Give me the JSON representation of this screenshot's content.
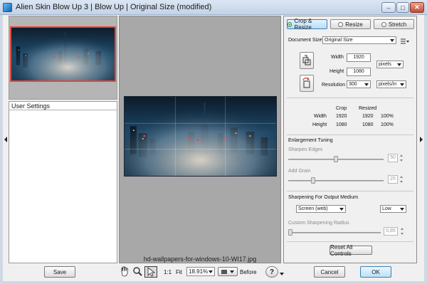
{
  "window": {
    "title": "Alien Skin Blow Up 3 | Blow Up | Original Size (modified)",
    "minimize": "–",
    "maximize": "□",
    "close": "✕"
  },
  "left_panel": {
    "settings_header": "User Settings",
    "save_label": "Save"
  },
  "preview": {
    "file_name": "hd-wallpapers-for-windows-10-WI17.jpg"
  },
  "toolbar": {
    "zoom_1to1": "1:1",
    "fit": "Fit",
    "zoom_value": "18.91%",
    "before": "Before",
    "help": "?"
  },
  "tabs": [
    {
      "label": "Crop & Resize",
      "selected": true
    },
    {
      "label": "Resize",
      "selected": false
    },
    {
      "label": "Stretch",
      "selected": false
    }
  ],
  "document": {
    "size_label": "Document Size",
    "size_value": "Original Size",
    "width_label": "Width",
    "width_value": "1920",
    "height_label": "Height",
    "height_value": "1080",
    "resolution_label": "Resolution",
    "resolution_value": "300",
    "unit_value": "pixels",
    "res_unit_value": "pixels/in"
  },
  "summary": {
    "headers": [
      "Crop",
      "Resized"
    ],
    "rows": [
      {
        "label": "Width",
        "crop": "1920",
        "resized": "1920",
        "pct": "100%"
      },
      {
        "label": "Height",
        "crop": "1080",
        "resized": "1080",
        "pct": "100%"
      }
    ]
  },
  "enlargement": {
    "section": "Enlargement Tuning",
    "sharpen_label": "Sharpen Edges",
    "sharpen_value": "50",
    "sharpen_level": 0.5,
    "grain_label": "Add Grain",
    "grain_value": "25",
    "grain_level": 0.25
  },
  "sharpening": {
    "section": "Sharpening For Output Medium",
    "medium_value": "Screen (web)",
    "amount_value": "Low",
    "radius_label": "Custom Sharpening Radius",
    "radius_value": "0,85",
    "radius_level": 0.0
  },
  "actions": {
    "reset": "Reset All Controls",
    "cancel": "Cancel",
    "ok": "OK"
  },
  "colors": {
    "accent": "#3f7fb7",
    "crop_border": "#e0483a"
  },
  "icons": {
    "crop": "crop-icon",
    "rotate": "rotate-icon",
    "hand": "hand-tool-icon",
    "zoom": "zoom-tool-icon",
    "select": "select-tool-icon",
    "help": "help-icon"
  }
}
